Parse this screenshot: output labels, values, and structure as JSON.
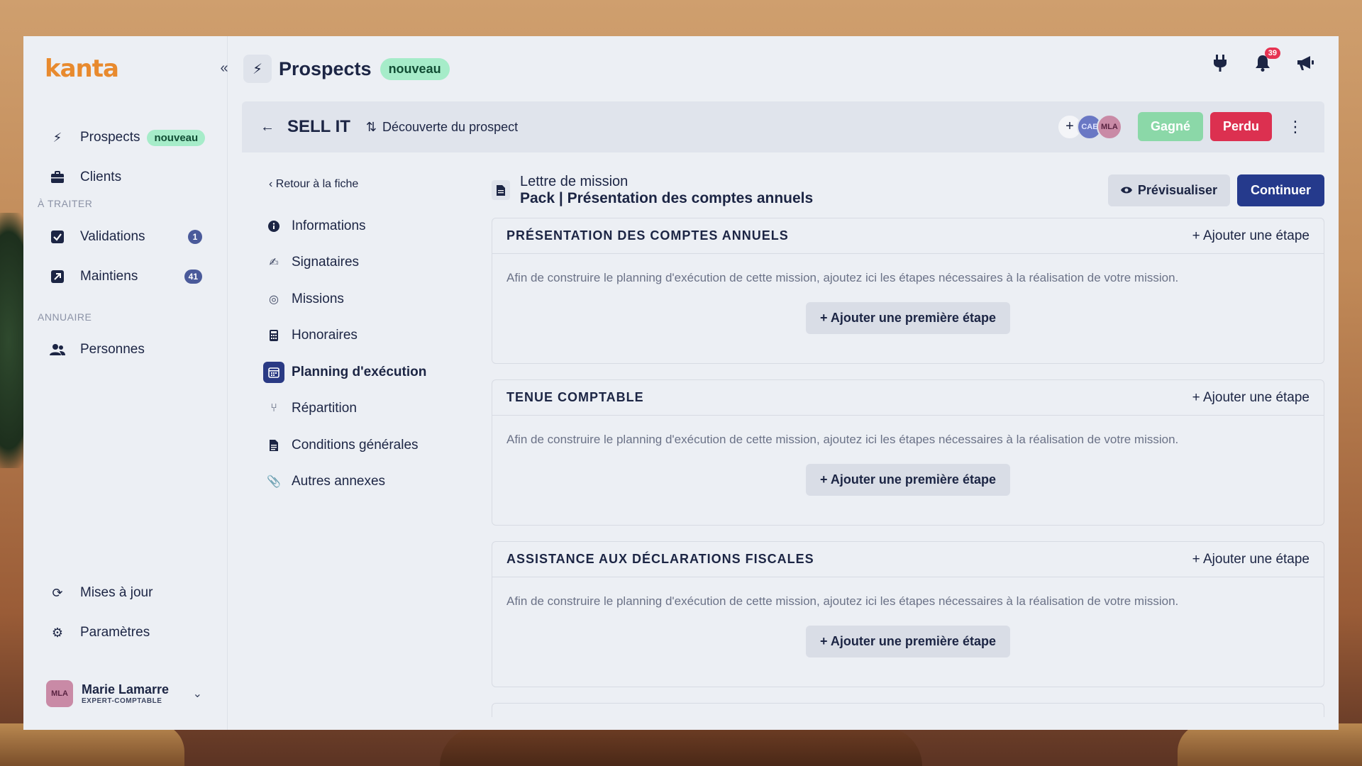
{
  "brand": {
    "logo_text": "kanta",
    "accent": "#e88a2e"
  },
  "sidebar": {
    "collapse_icon": "double-chevron-left-icon",
    "primary": [
      {
        "label": "Prospects",
        "badge": "nouveau",
        "icon": "bolt-icon"
      },
      {
        "label": "Clients",
        "icon": "briefcase-icon"
      }
    ],
    "section_to_process": "À TRAITER",
    "to_process": [
      {
        "label": "Validations",
        "count": "1",
        "icon": "checkbox-icon"
      },
      {
        "label": "Maintiens",
        "count": "41",
        "icon": "arrow-up-right-icon"
      }
    ],
    "section_directory": "ANNUAIRE",
    "directory": [
      {
        "label": "Personnes",
        "icon": "people-icon"
      }
    ],
    "bottom": [
      {
        "label": "Mises à jour",
        "icon": "refresh-icon"
      },
      {
        "label": "Paramètres",
        "icon": "gear-icon"
      }
    ],
    "user": {
      "initials": "MLA",
      "name": "Marie Lamarre",
      "role": "EXPERT-COMPTABLE"
    }
  },
  "header": {
    "title": "Prospects",
    "badge": "nouveau",
    "notifications_count": "39",
    "icons": [
      "plug-icon",
      "bell-icon",
      "megaphone-icon"
    ]
  },
  "subheader": {
    "title": "SELL IT",
    "step": "Découverte du prospect",
    "avatars": [
      "CAE",
      "MLA"
    ],
    "won_label": "Gagné",
    "lost_label": "Perdu"
  },
  "steps_nav": {
    "return_label": "Retour à la fiche",
    "items": [
      {
        "label": "Informations",
        "icon": "info-icon"
      },
      {
        "label": "Signataires",
        "icon": "signature-icon"
      },
      {
        "label": "Missions",
        "icon": "target-icon"
      },
      {
        "label": "Honoraires",
        "icon": "calculator-icon"
      },
      {
        "label": "Planning d'exécution",
        "icon": "calendar-icon",
        "active": true
      },
      {
        "label": "Répartition",
        "icon": "split-icon"
      },
      {
        "label": "Conditions générales",
        "icon": "document-icon"
      },
      {
        "label": "Autres annexes",
        "icon": "paperclip-icon"
      }
    ]
  },
  "document": {
    "title": "Lettre de mission",
    "subtitle": "Pack | Présentation des comptes annuels",
    "preview_label": "Prévisualiser",
    "continue_label": "Continuer"
  },
  "cards": [
    {
      "title": "PRÉSENTATION DES COMPTES ANNUELS",
      "add_label": "Ajouter une étape",
      "description": "Afin de construire le planning d'exécution de cette mission, ajoutez ici les étapes nécessaires à la réalisation de votre mission.",
      "first_step_label": "Ajouter une première étape"
    },
    {
      "title": "TENUE COMPTABLE",
      "add_label": "Ajouter une étape",
      "description": "Afin de construire le planning d'exécution de cette mission, ajoutez ici les étapes nécessaires à la réalisation de votre mission.",
      "first_step_label": "Ajouter une première étape"
    },
    {
      "title": "ASSISTANCE AUX DÉCLARATIONS FISCALES",
      "add_label": "Ajouter une étape",
      "description": "Afin de construire le planning d'exécution de cette mission, ajoutez ici les étapes nécessaires à la réalisation de votre mission.",
      "first_step_label": "Ajouter une première étape"
    }
  ]
}
